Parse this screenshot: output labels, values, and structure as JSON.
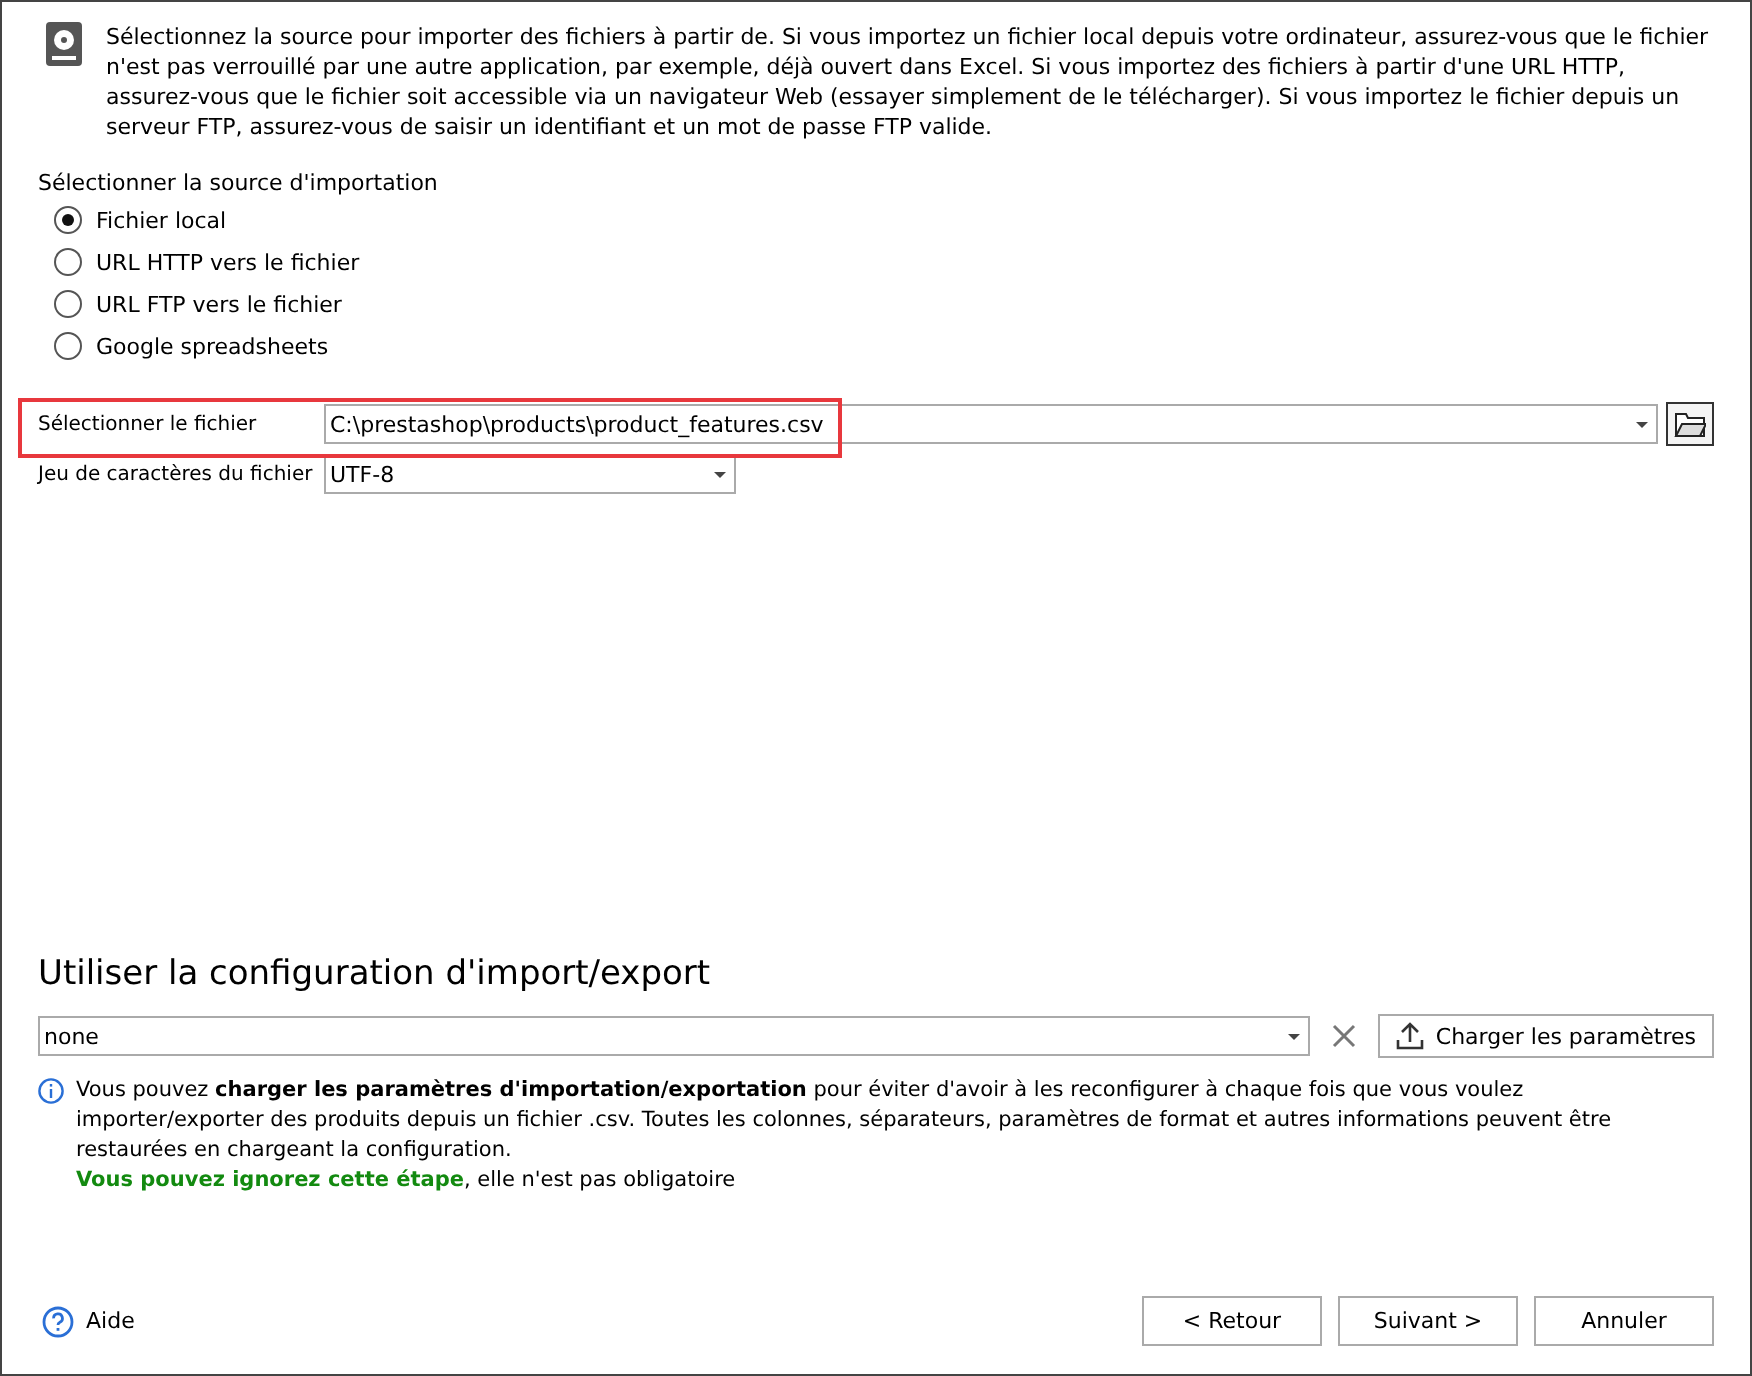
{
  "intro": "Sélectionnez la source pour importer des fichiers à partir de. Si vous importez un fichier local depuis votre ordinateur, assurez-vous que le fichier n'est pas verrouillé par une autre application, par exemple, déjà ouvert dans Excel. Si vous importez des fichiers à partir d'une URL HTTP, assurez-vous que le fichier soit accessible via un navigateur Web (essayer simplement de le télécharger). Si vous importez le fichier depuis un serveur FTP, assurez-vous de saisir un identifiant et un mot de passe FTP valide.",
  "source": {
    "label": "Sélectionner la source d'importation",
    "options": [
      {
        "label": "Fichier local",
        "selected": true
      },
      {
        "label": "URL HTTP vers le fichier",
        "selected": false
      },
      {
        "label": "URL FTP vers le fichier",
        "selected": false
      },
      {
        "label": "Google spreadsheets",
        "selected": false
      }
    ]
  },
  "file": {
    "label": "Sélectionner le fichier",
    "value": "C:\\prestashop\\products\\product_features.csv",
    "highlighted": true
  },
  "charset": {
    "label": "Jeu de caractères du fichier",
    "value": "UTF-8"
  },
  "config": {
    "heading": "Utiliser la configuration d'import/export",
    "value": "none",
    "load_button": "Charger les paramètres",
    "info": "Vous pouvez **charger les paramètres d'importation/exportation** pour éviter d'avoir à les reconfigurer à chaque fois que vous voulez importer/exporter des produits depuis un fichier .csv. Toutes les colonnes, séparateurs, paramètres de format et autres informations peuvent être restaurées en chargeant la configuration.",
    "skip_emphasis": "Vous pouvez ignorez cette étape",
    "skip_rest": ", elle n'est pas obligatoire"
  },
  "help": "Aide",
  "buttons": [
    "< Retour",
    "Suivant >",
    "Annuler"
  ]
}
